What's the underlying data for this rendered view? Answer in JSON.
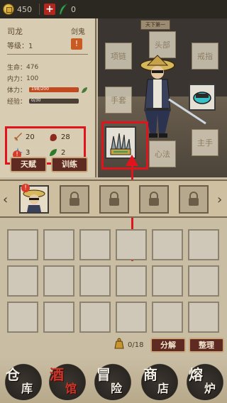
{
  "topbar": {
    "gold": "450",
    "gems": "0",
    "gold_icon": "coin-icon",
    "health_icon": "plus-icon",
    "gem_icon": "feather-icon"
  },
  "character": {
    "name": "司龙",
    "class": "剑鬼",
    "level_label": "等级：",
    "level": "1",
    "warn": "!",
    "hp_label": "生命：",
    "hp": "476",
    "mp_label": "内力：",
    "mp": "100",
    "stamina_label": "体力：",
    "stamina_text": "198/200",
    "stamina_fraction": 0.99,
    "exp_label": "经验：",
    "exp_text": "0/30",
    "exp_fraction": 0.0,
    "attributes": [
      {
        "icon": "sword-icon",
        "value": "20"
      },
      {
        "icon": "fist-icon",
        "value": "28"
      },
      {
        "icon": "star-icon",
        "value": "3"
      },
      {
        "icon": "leaf-icon",
        "value": "2"
      }
    ],
    "talent_button": "天赋",
    "train_button": "训练",
    "talent_alert": "!"
  },
  "scene": {
    "plaque": "天下第一",
    "slots": {
      "head": "头部",
      "necklace": "项链",
      "ring": "戒指",
      "gloves": "手套",
      "main_hand": "主手",
      "heart": "心法"
    }
  },
  "tabs": {
    "left_arrow": "‹",
    "right_arrow": "›",
    "alert": "!"
  },
  "inventory": {
    "count": "0/18",
    "split_button": "分解",
    "sort_button": "整理"
  },
  "nav": {
    "warehouse": [
      "仓",
      "库"
    ],
    "tavern": [
      "酒",
      "馆"
    ],
    "adventure": [
      "冒",
      "险"
    ],
    "shop": [
      "商",
      "店"
    ],
    "forge": [
      "熔",
      "炉"
    ]
  },
  "colors": {
    "accent_red": "#e0141a",
    "button": "#5e2a22",
    "stamina": "#c24a1e",
    "gold": "#d7a93a"
  }
}
